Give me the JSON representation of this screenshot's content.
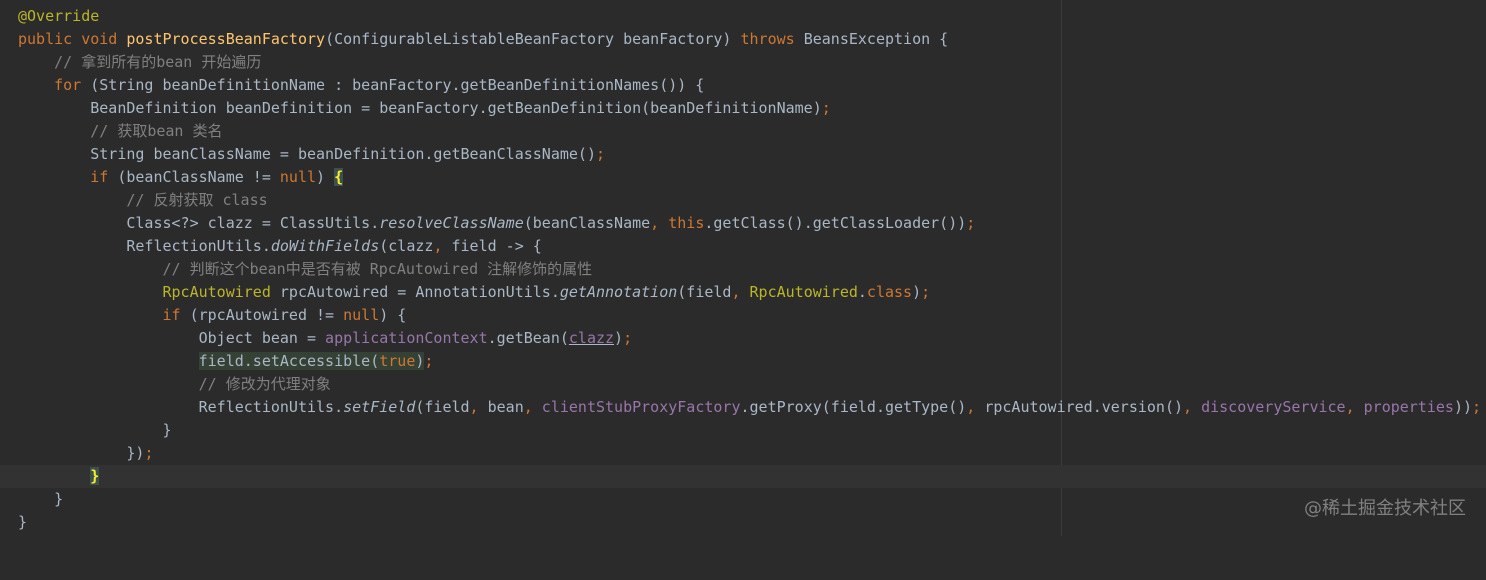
{
  "editor": {
    "lines": [
      "@Override",
      "public void postProcessBeanFactory(ConfigurableListableBeanFactory beanFactory) throws BeansException {",
      "    // 拿到所有的bean 开始遍历",
      "    for (String beanDefinitionName : beanFactory.getBeanDefinitionNames()) {",
      "        BeanDefinition beanDefinition = beanFactory.getBeanDefinition(beanDefinitionName);",
      "        // 获取bean 类名",
      "        String beanClassName = beanDefinition.getBeanClassName();",
      "        if (beanClassName != null) {",
      "            // 反射获取 class",
      "            Class<?> clazz = ClassUtils.resolveClassName(beanClassName, this.getClass().getClassLoader());",
      "            ReflectionUtils.doWithFields(clazz, field -> {",
      "                // 判断这个bean中是否有被 RpcAutowired 注解修饰的属性",
      "                RpcAutowired rpcAutowired = AnnotationUtils.getAnnotation(field, RpcAutowired.class);",
      "                if (rpcAutowired != null) {",
      "                    Object bean = applicationContext.getBean(clazz);",
      "                    field.setAccessible(true);",
      "                    // 修改为代理对象",
      "                    ReflectionUtils.setField(field, bean, clientStubProxyFactory.getProxy(field.getType(), rpcAutowired.version(), discoveryService, properties));",
      "                }",
      "            });",
      "        }",
      "    }",
      "}"
    ],
    "current_line": 21
  },
  "watermark": "@稀土掘金技术社区",
  "colors": {
    "background": "#2b2b2b",
    "text": "#a9b7c6",
    "keyword": "#cc7832",
    "annotation": "#bbb529",
    "method_decl": "#ffc66d",
    "comment": "#808080",
    "field": "#9876aa",
    "current_line": "#323232"
  }
}
